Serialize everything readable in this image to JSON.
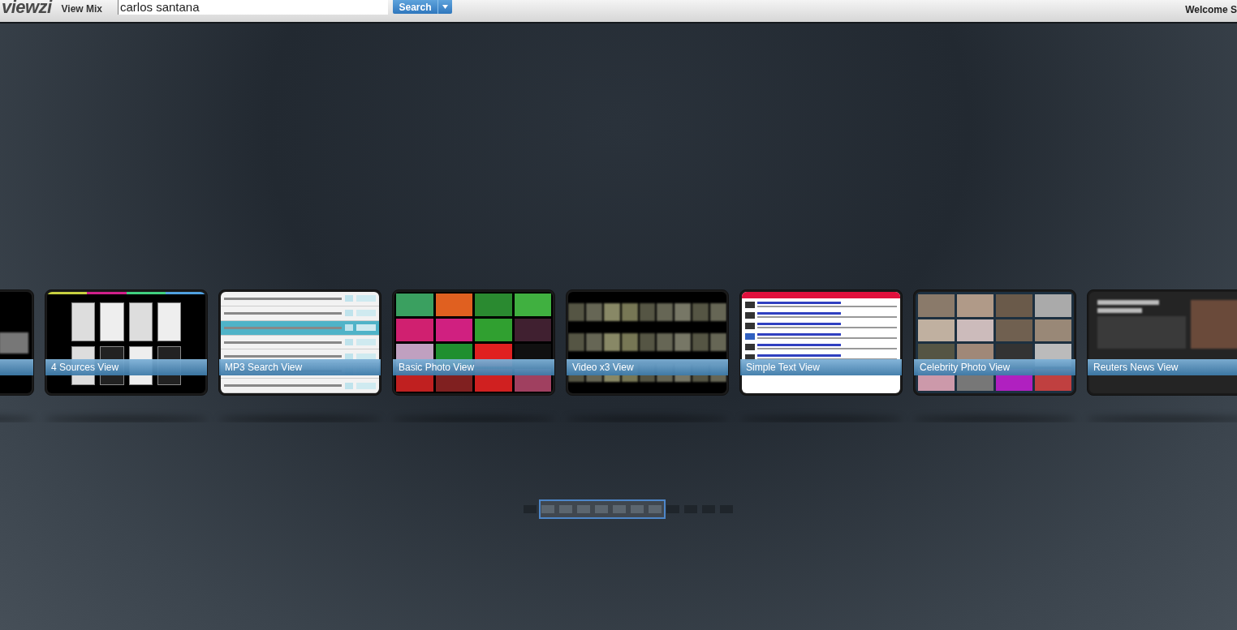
{
  "header": {
    "logo": "viewzi",
    "view_mix": "View Mix",
    "search": {
      "value": "carlos santana"
    },
    "search_button": "Search",
    "welcome": "Welcome S"
  },
  "views": [
    {
      "kind": "blank"
    },
    {
      "kind": "sources",
      "label": "4 Sources View"
    },
    {
      "kind": "list",
      "label": "MP3 Search View"
    },
    {
      "kind": "photo",
      "label": "Basic Photo View"
    },
    {
      "kind": "video",
      "label": "Video x3 View"
    },
    {
      "kind": "text",
      "label": "Simple Text View"
    },
    {
      "kind": "collage",
      "label": "Celebrity Photo View"
    },
    {
      "kind": "news",
      "label": "Reuters News View"
    }
  ],
  "pager": [
    {
      "selected": false
    },
    {
      "selected": true
    },
    {
      "selected": true
    },
    {
      "selected": true
    },
    {
      "selected": true
    },
    {
      "selected": true
    },
    {
      "selected": true
    },
    {
      "selected": true
    },
    {
      "selected": false
    },
    {
      "selected": false
    },
    {
      "selected": false
    },
    {
      "selected": false
    }
  ]
}
